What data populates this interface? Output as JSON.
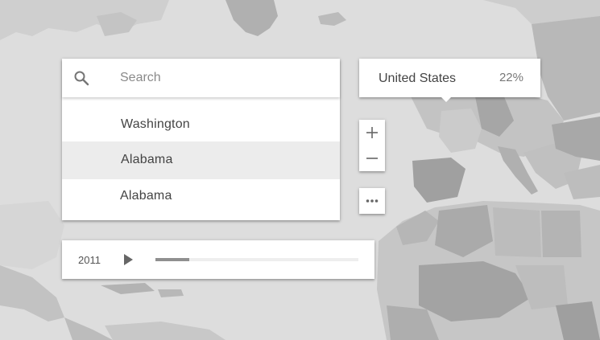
{
  "search": {
    "placeholder": "Search",
    "icon": "search-icon",
    "results": [
      {
        "label": "Washington"
      },
      {
        "label": "Alabama",
        "highlighted": true
      },
      {
        "label": "Alabama"
      }
    ]
  },
  "tooltip": {
    "country": "United States",
    "value": "22%"
  },
  "zoom": {
    "in_icon": "plus-icon",
    "out_icon": "minus-icon"
  },
  "more": {
    "icon": "more-horizontal-icon"
  },
  "timeline": {
    "year": "2011",
    "play_icon": "play-icon",
    "progress": 0.165
  },
  "colors": {
    "map_background": "#dddddd",
    "land_light": "#c9c9c9",
    "land_mid": "#b3b3b3",
    "land_dark": "#9c9c9c",
    "panel": "#ffffff",
    "highlight_row": "#ececec",
    "track": "#eeeeee",
    "track_fill": "#909090"
  }
}
